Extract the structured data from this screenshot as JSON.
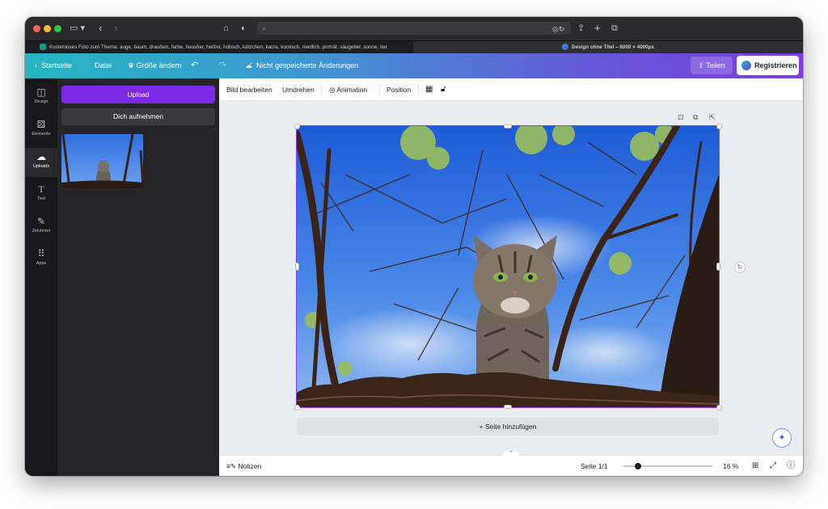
{
  "browser": {
    "url_placeholder": "",
    "tabs": [
      {
        "title": "Kostenloses Foto zum Thema: auge, baum, draußen, farbe, haustier, herbst, hübsch, kätzchen, katze, komisch, niedlich, porträt, säugetier, sonne, tier",
        "active": false
      },
      {
        "title": "Design ohne Titel – 6000 × 4000px",
        "active": true
      }
    ]
  },
  "topbar": {
    "home": "Startseite",
    "file": "Datei",
    "resize": "Größe ändern",
    "unsaved": "Nicht gespeicherte Änderungen",
    "share": "Teilen",
    "register": "Registrieren"
  },
  "rail": [
    {
      "label": "Design",
      "icon": "design-icon"
    },
    {
      "label": "Elemente",
      "icon": "elements-icon"
    },
    {
      "label": "Uploads",
      "icon": "upload-cloud-icon",
      "selected": true
    },
    {
      "label": "Text",
      "icon": "text-icon"
    },
    {
      "label": "Zeichnen",
      "icon": "draw-icon"
    },
    {
      "label": "Apps",
      "icon": "apps-grid-icon"
    }
  ],
  "panel": {
    "upload": "Upload",
    "record": "Dich aufnehmen"
  },
  "toolbar": {
    "edit_image": "Bild bearbeiten",
    "flip": "Umdrehen",
    "animation": "Animation",
    "position": "Position"
  },
  "canvas": {
    "add_page": "+ Seite hinzufügen"
  },
  "bottombar": {
    "notes": "Notizen",
    "page": "Seite 1/1",
    "zoom": "16 %",
    "zoom_fraction": 0.16
  },
  "colors": {
    "accent_purple": "#7d2ae8",
    "gradient_start": "#25b5c3",
    "gradient_end": "#7d3ee0"
  }
}
